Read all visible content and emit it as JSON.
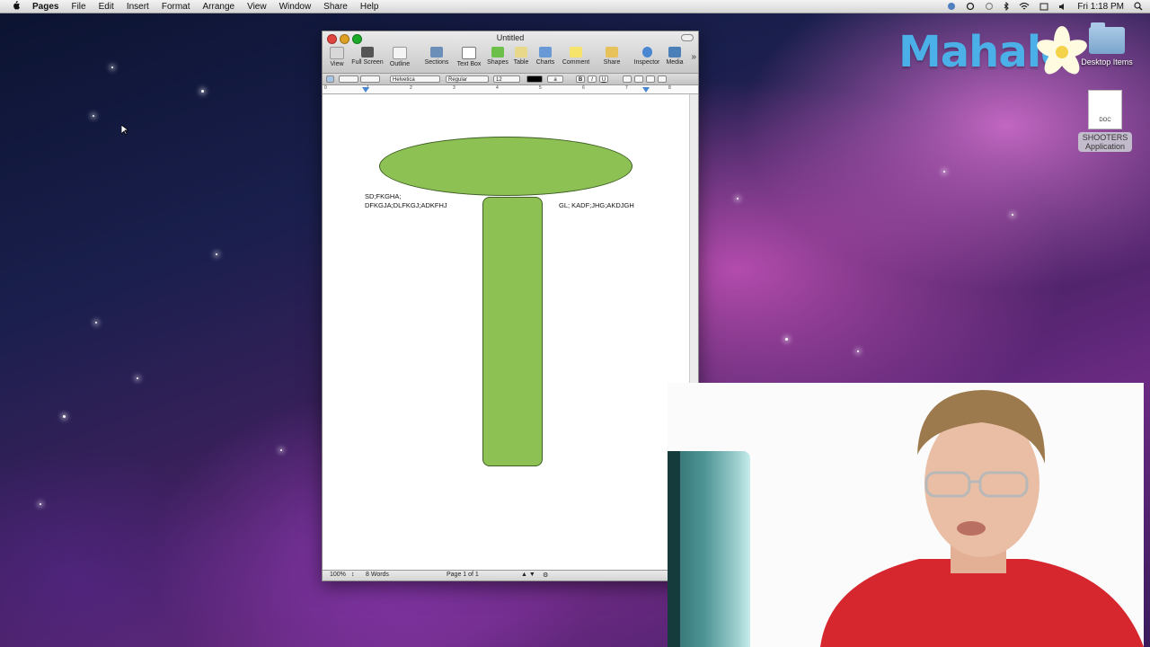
{
  "menubar": {
    "apple": "",
    "items": [
      "Pages",
      "File",
      "Edit",
      "Insert",
      "Format",
      "Arrange",
      "View",
      "Window",
      "Share",
      "Help"
    ],
    "clock": "Fri 1:18 PM"
  },
  "desktop": {
    "logo": "Mahalo",
    "folder_label": "Desktop Items",
    "doc_badge": "DOC",
    "doc_label_1": "SHOOTERS",
    "doc_label_2": "Application"
  },
  "window": {
    "title": "Untitled",
    "toolbar": [
      "View",
      "Full Screen",
      "Outline",
      "Sections",
      "Text Box",
      "Shapes",
      "Table",
      "Charts",
      "Comment",
      "Share",
      "Inspector",
      "Media"
    ],
    "format": {
      "font": "Helvetica",
      "style": "Regular",
      "size": "12",
      "a_label": "a",
      "bold": "B",
      "italic": "I",
      "underline": "U"
    },
    "ruler": [
      "0",
      "1",
      "2",
      "3",
      "4",
      "5",
      "6",
      "7",
      "8"
    ],
    "doc_text": {
      "left_line1": "SD;FKGHA;",
      "left_line2": "DFKGJA;DLFKGJ;ADKFHJ",
      "right_line": "GL; KADF;JHG;AKDJGH"
    },
    "status": {
      "zoom": "100%",
      "words": "8 Words",
      "page": "Page 1 of 1"
    }
  },
  "colors": {
    "shape_fill": "#8dc153",
    "shape_stroke": "#3f5f26",
    "logo": "#4cb0e8"
  }
}
